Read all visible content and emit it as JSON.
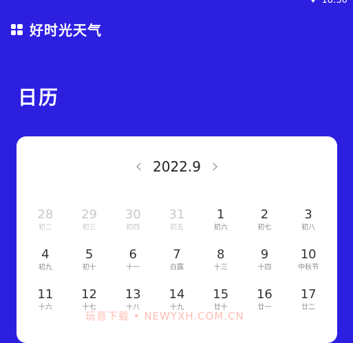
{
  "status_bar": {
    "time": "18:30"
  },
  "header": {
    "app_name": "好时光天气"
  },
  "page": {
    "title": "日历"
  },
  "calendar": {
    "month_label": "2022.9",
    "days": [
      {
        "day": "28",
        "lunar": "初二",
        "other": true
      },
      {
        "day": "29",
        "lunar": "初三",
        "other": true
      },
      {
        "day": "30",
        "lunar": "初四",
        "other": true
      },
      {
        "day": "31",
        "lunar": "初五",
        "other": true
      },
      {
        "day": "1",
        "lunar": "初六",
        "other": false
      },
      {
        "day": "2",
        "lunar": "初七",
        "other": false
      },
      {
        "day": "3",
        "lunar": "初八",
        "other": false
      },
      {
        "day": "4",
        "lunar": "初九",
        "other": false
      },
      {
        "day": "5",
        "lunar": "初十",
        "other": false
      },
      {
        "day": "6",
        "lunar": "十一",
        "other": false
      },
      {
        "day": "7",
        "lunar": "白露",
        "other": false
      },
      {
        "day": "8",
        "lunar": "十三",
        "other": false
      },
      {
        "day": "9",
        "lunar": "十四",
        "other": false
      },
      {
        "day": "10",
        "lunar": "中秋节",
        "other": false
      },
      {
        "day": "11",
        "lunar": "十六",
        "other": false
      },
      {
        "day": "12",
        "lunar": "十七",
        "other": false
      },
      {
        "day": "13",
        "lunar": "十八",
        "other": false
      },
      {
        "day": "14",
        "lunar": "十九",
        "other": false
      },
      {
        "day": "15",
        "lunar": "廿十",
        "other": false
      },
      {
        "day": "16",
        "lunar": "廿一",
        "other": false
      },
      {
        "day": "17",
        "lunar": "廿二",
        "other": false
      }
    ]
  },
  "watermark": "玩意下载 • NEWYXH.COM.CN"
}
